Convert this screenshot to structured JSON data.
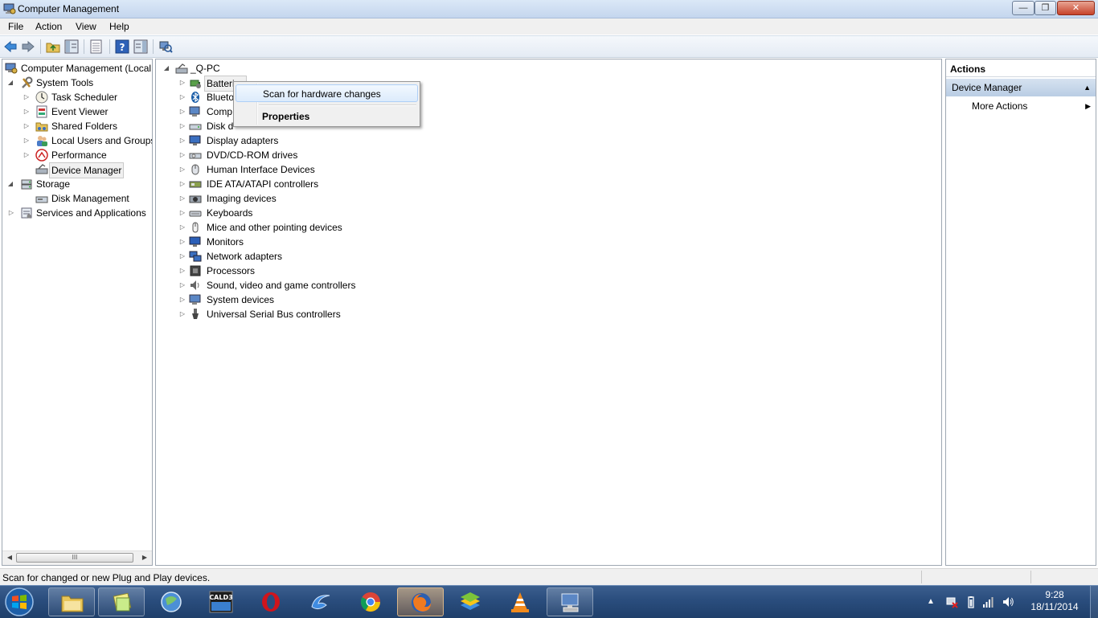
{
  "window": {
    "title": "Computer Management",
    "minimize": "—",
    "maximize": "❐",
    "close": "✕"
  },
  "menu": {
    "file": "File",
    "action": "Action",
    "view": "View",
    "help": "Help"
  },
  "left_tree": {
    "root": "Computer Management (Local",
    "system_tools": "System Tools",
    "task_scheduler": "Task Scheduler",
    "event_viewer": "Event Viewer",
    "shared_folders": "Shared Folders",
    "local_users": "Local Users and Groups",
    "performance": "Performance",
    "device_manager": "Device Manager",
    "storage": "Storage",
    "disk_management": "Disk Management",
    "services": "Services and Applications",
    "scroll_grip": "III"
  },
  "device_tree": {
    "root": "_Q-PC",
    "items": [
      "Batteries",
      "Blueto",
      "Comp",
      "Disk d",
      "Display adapters",
      "DVD/CD-ROM drives",
      "Human Interface Devices",
      "IDE ATA/ATAPI controllers",
      "Imaging devices",
      "Keyboards",
      "Mice and other pointing devices",
      "Monitors",
      "Network adapters",
      "Processors",
      "Sound, video and game controllers",
      "System devices",
      "Universal Serial Bus controllers"
    ]
  },
  "context_menu": {
    "scan": "Scan for hardware changes",
    "properties": "Properties"
  },
  "actions": {
    "header": "Actions",
    "section": "Device Manager",
    "more": "More Actions"
  },
  "status": {
    "text": "Scan for changed or new Plug and Play devices."
  },
  "taskbar": {
    "cald3_label": "CALD3",
    "time": "9:28",
    "date": "18/11/2014"
  },
  "colors": {
    "title_bar": "#c4d6ee",
    "taskbar": "#2a4d7d",
    "selection": "#dcebfc",
    "actions_header": "#b9cde4"
  }
}
